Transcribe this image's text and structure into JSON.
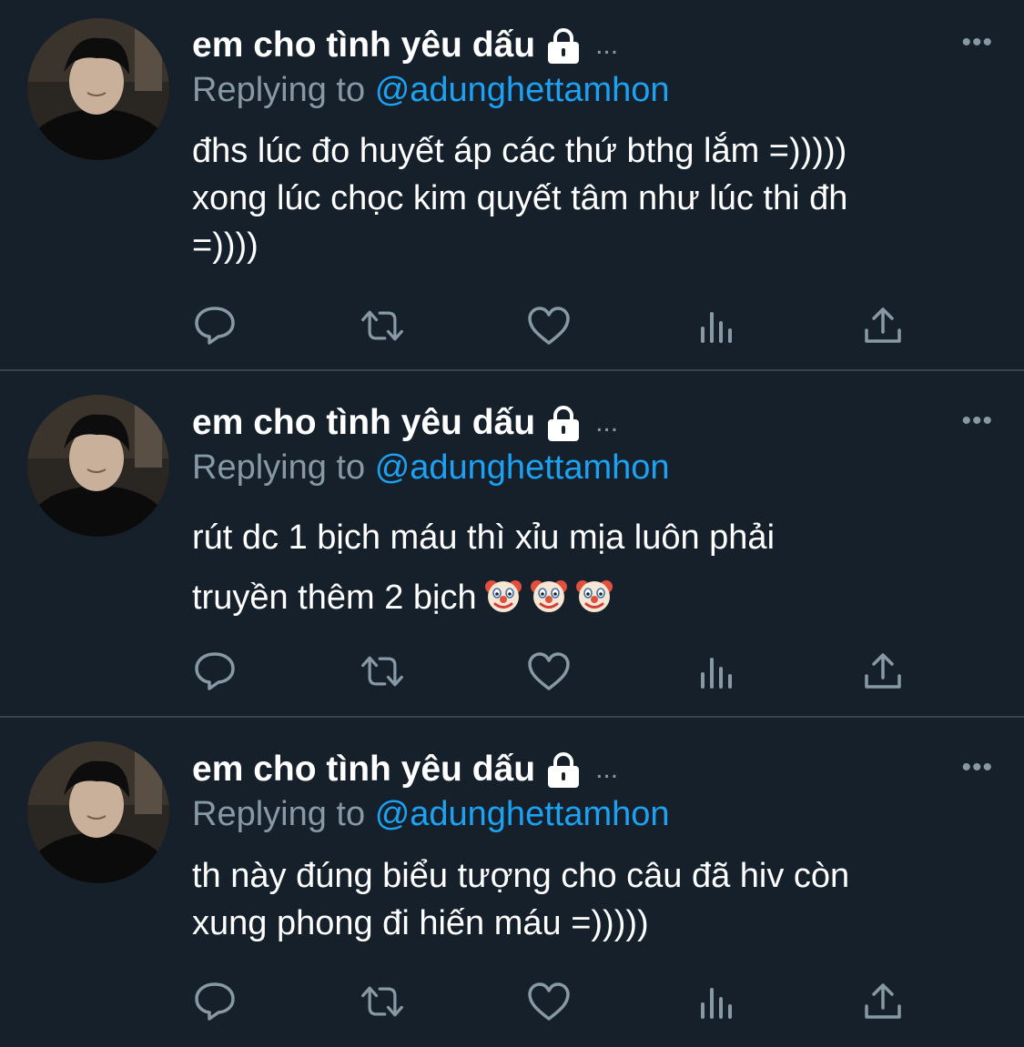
{
  "tweets": [
    {
      "display_name": "em cho tình yêu dấu",
      "ellipsis": "...",
      "more": "•••",
      "replying_label": "Replying to",
      "replying_handle": "@adunghettamhon",
      "text": "đhs lúc đo huyết áp các thứ bthg lắm =)))))\nxong lúc chọc kim quyết tâm như lúc thi đh\n=))))"
    },
    {
      "display_name": "em cho tình yêu dấu",
      "ellipsis": "...",
      "more": "•••",
      "replying_label": "Replying to",
      "replying_handle": "@adunghettamhon",
      "text": "rút dc 1 bịch máu thì xỉu mịa luôn phải\ntruyền thêm 2 bịch",
      "emoji": [
        "clown-face",
        "clown-face",
        "clown-face"
      ]
    },
    {
      "display_name": "em cho tình yêu dấu",
      "ellipsis": "...",
      "more": "•••",
      "replying_label": "Replying to",
      "replying_handle": "@adunghettamhon",
      "text": "th này đúng biểu tượng cho câu đã hiv còn\nxung phong đi hiến máu =)))))"
    }
  ],
  "action_icons": [
    "reply-icon",
    "retweet-icon",
    "like-icon",
    "analytics-icon",
    "share-icon"
  ],
  "colors": {
    "background": "#15202b",
    "divider": "#38444d",
    "secondary_text": "#8899a6",
    "link": "#1da1f2",
    "primary_text": "#ffffff"
  }
}
